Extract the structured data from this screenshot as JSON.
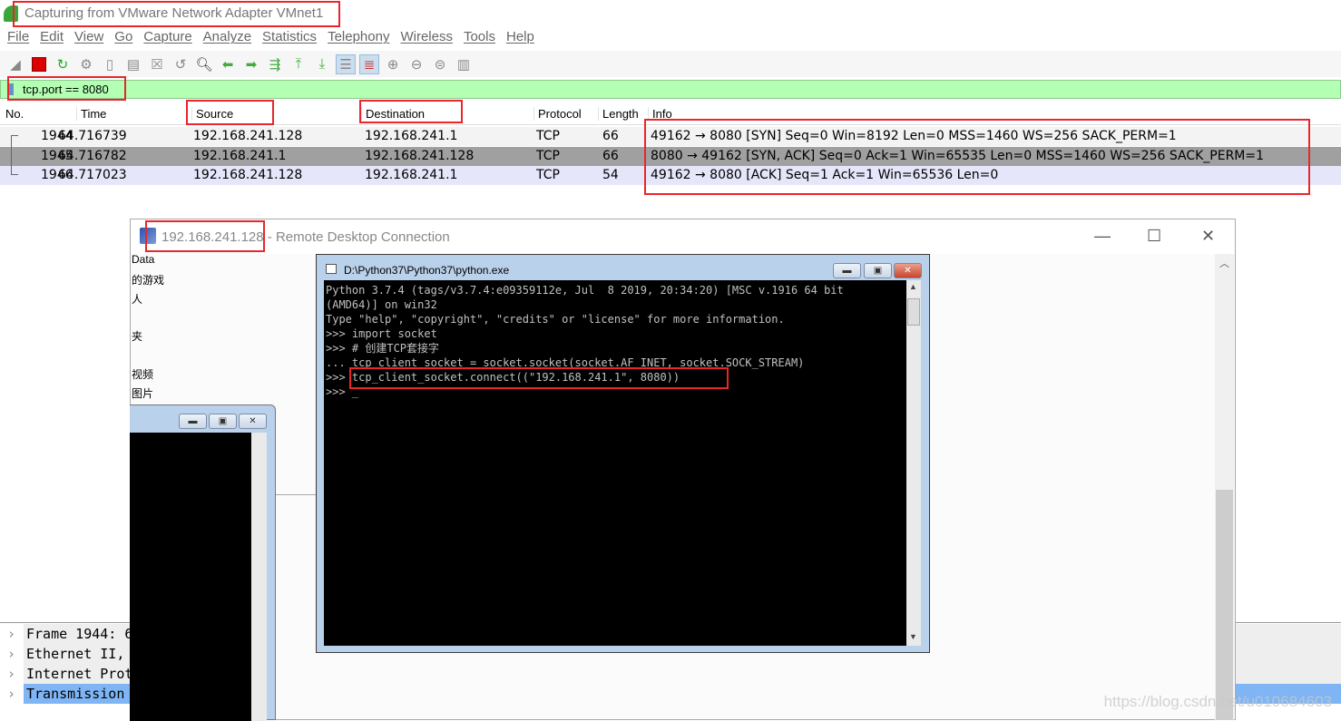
{
  "wireshark": {
    "title": "Capturing from VMware Network Adapter VMnet1",
    "menu": [
      "File",
      "Edit",
      "View",
      "Go",
      "Capture",
      "Analyze",
      "Statistics",
      "Telephony",
      "Wireless",
      "Tools",
      "Help"
    ],
    "filter": "tcp.port == 8080",
    "columns": [
      "No.",
      "Time",
      "Source",
      "Destination",
      "Protocol",
      "Length",
      "Info"
    ],
    "rows": [
      {
        "no": "1944",
        "time": "64.716739",
        "src": "192.168.241.128",
        "dst": "192.168.241.1",
        "proto": "TCP",
        "len": "66",
        "info": "49162 → 8080 [SYN] Seq=0 Win=8192 Len=0 MSS=1460 WS=256 SACK_PERM=1"
      },
      {
        "no": "1945",
        "time": "64.716782",
        "src": "192.168.241.1",
        "dst": "192.168.241.128",
        "proto": "TCP",
        "len": "66",
        "info": "8080 → 49162 [SYN, ACK] Seq=0 Ack=1 Win=65535 Len=0 MSS=1460 WS=256 SACK_PERM=1"
      },
      {
        "no": "1946",
        "time": "64.717023",
        "src": "192.168.241.128",
        "dst": "192.168.241.1",
        "proto": "TCP",
        "len": "54",
        "info": "49162 → 8080 [ACK] Seq=1 Ack=1 Win=65536 Len=0"
      }
    ],
    "details": [
      "Frame 1944: 6",
      "Ethernet II,",
      "Internet Prot",
      "Transmission"
    ]
  },
  "rdp": {
    "ip": "192.168.241.128",
    "rest": " - Remote Desktop Connection",
    "sidebar": [
      "Data",
      "的游戏",
      "人",
      "",
      "夹",
      "",
      "视频",
      "图片"
    ]
  },
  "console": {
    "title": "D:\\Python37\\Python37\\python.exe",
    "lines": [
      "Python 3.7.4 (tags/v3.7.4:e09359112e, Jul  8 2019, 20:34:20) [MSC v.1916 64 bit",
      "(AMD64)] on win32",
      "Type \"help\", \"copyright\", \"credits\" or \"license\" for more information.",
      ">>> import socket",
      ">>> # 创建TCP套接字",
      "... tcp_client_socket = socket.socket(socket.AF_INET, socket.SOCK_STREAM)",
      ">>> tcp_client_socket.connect((\"192.168.241.1\", 8080))",
      ">>> _"
    ]
  },
  "watermark": "https://blog.csdn.net/u010684603",
  "colors": {
    "filter_bg": "#b3ffb3",
    "selected_detail": "#7fb5f5",
    "highlight": "#e8262b"
  }
}
